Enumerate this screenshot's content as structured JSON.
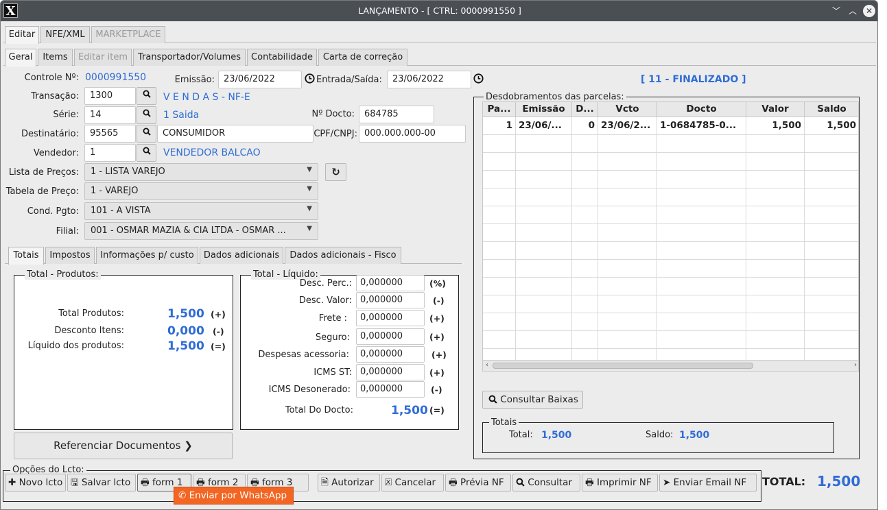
{
  "window": {
    "title": "LANÇAMENTO - [ CTRL: 0000991550 ]",
    "logo": "X",
    "minimize": "﹀",
    "maximize": "︿",
    "close": "✕"
  },
  "top_tabs": [
    "Editar",
    "NFE/XML",
    "MARKETPLACE"
  ],
  "sub_tabs": [
    "Geral",
    "Items",
    "Editar item",
    "Transportador/Volumes",
    "Contabilidade",
    "Carta de correção"
  ],
  "form": {
    "controle_label": "Controle Nº:",
    "controle_value": "0000991550",
    "emissao_label": "Emissão:",
    "emissao_value": "23/06/2022",
    "entrada_label": "Entrada/Saída:",
    "entrada_value": "23/06/2022",
    "status": "[ 11 - FINALIZADO ]",
    "transacao_label": "Transação:",
    "transacao_value": "1300",
    "transacao_desc": "V E N D A S - NF-E",
    "serie_label": "Série:",
    "serie_value": "14",
    "serie_desc": "1 Saida",
    "ndocto_label": "Nº Docto:",
    "ndocto_value": "684785",
    "destinatario_label": "Destinatário:",
    "destinatario_value": "95565",
    "destinatario_name": "CONSUMIDOR",
    "cpf_label": "CPF/CNPJ:",
    "cpf_value": "000.000.000-00",
    "vendedor_label": "Vendedor:",
    "vendedor_value": "1",
    "vendedor_desc": "VENDEDOR BALCAO",
    "lista_label": "Lista de Preços:",
    "lista_value": "1 - LISTA VAREJO",
    "tabela_label": "Tabela de Preço:",
    "tabela_value": "1 - VAREJO",
    "cond_label": "Cond. Pgto:",
    "cond_value": "101 - A VISTA",
    "filial_label": "Filial:",
    "filial_value": "001 - OSMAR MAZIA & CIA LTDA - OSMAR ..."
  },
  "totals_tabs": [
    "Totais",
    "Impostos",
    "Informações p/ custo",
    "Dados adicionais",
    "Dados adicionais - Fisco"
  ],
  "produtos": {
    "legend": "Total - Produtos:",
    "rows": [
      {
        "label": "Total Produtos:",
        "value": "1,500",
        "sym": "(+)"
      },
      {
        "label": "Desconto Itens:",
        "value": "0,000",
        "sym": "(-)"
      },
      {
        "label": "Líquido dos produtos:",
        "value": "1,500",
        "sym": "(=)"
      }
    ]
  },
  "liquido": {
    "legend": "Total - Líquido:",
    "rows": [
      {
        "label": "Desc. Perc.:",
        "value": "0,000000",
        "sym": "(%)"
      },
      {
        "label": "Desc. Valor:",
        "value": "0,000000",
        "sym": "(-)"
      },
      {
        "label": "Frete :",
        "value": "0,000000",
        "sym": "(+)"
      },
      {
        "label": "Seguro:",
        "value": "0,000000",
        "sym": "(+)"
      },
      {
        "label": "Despesas acessoria:",
        "value": "0,000000",
        "sym": "(+)"
      },
      {
        "label": "ICMS ST:",
        "value": "0,000000",
        "sym": "(+)"
      },
      {
        "label": "ICMS Desonerado:",
        "value": "0,000000",
        "sym": "(-)"
      }
    ],
    "total_label": "Total Do Docto:",
    "total_value": "1,500",
    "total_sym": "(=)"
  },
  "referenciar": "Referenciar Documentos ❯",
  "parcelas": {
    "legend": "Desdobramentos das parcelas:",
    "columns": [
      "Pa...",
      "Emissão",
      "D...",
      "Vcto",
      "Docto",
      "Valor",
      "Saldo"
    ],
    "rows": [
      [
        "1",
        "23/06/...",
        "0",
        "23/06/2...",
        "1-0684785-0...",
        "1,500",
        "1,500"
      ]
    ]
  },
  "consultar_baixas": "Consultar Baixas",
  "totais_box": {
    "legend": "Totais",
    "total_label": "Total:",
    "total_value": "1,500",
    "saldo_label": "Saldo:",
    "saldo_value": "1,500"
  },
  "opcoes_legend": "Opções do Lcto:",
  "buttons": {
    "novo": "Novo lcto",
    "salvar": "Salvar lcto",
    "form1": "form 1",
    "form2": "form 2",
    "form3": "form 3",
    "autorizar": "Autorizar",
    "cancelar": "Cancelar",
    "previa": "Prévia NF",
    "consultar": "Consultar",
    "imprimir": "Imprimir NF",
    "email": "Enviar Email NF"
  },
  "grand_total_label": "TOTAL:",
  "grand_total_value": "1,500",
  "popup": "Enviar por WhatsApp"
}
